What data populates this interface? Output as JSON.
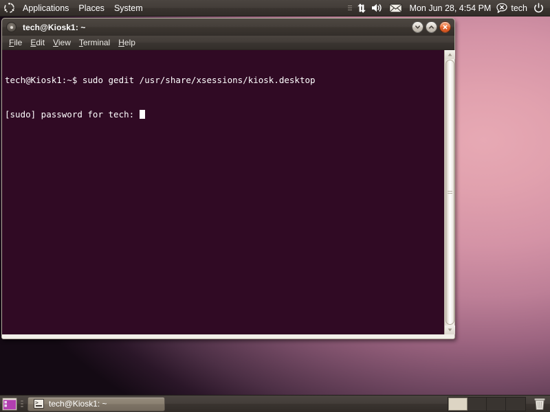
{
  "desktop": {
    "wallpaper_colors": [
      "#e7a9b4",
      "#bd7f97",
      "#4c2f45",
      "#140a14"
    ]
  },
  "top_panel": {
    "logo_icon": "ubuntu-logo-icon",
    "menus": [
      {
        "label": "Applications",
        "name": "menu-applications"
      },
      {
        "label": "Places",
        "name": "menu-places"
      },
      {
        "label": "System",
        "name": "menu-system"
      }
    ],
    "tray": {
      "indicator_applet_icon": "indicator-handle-icon",
      "network_icon": "network-up-down-icon",
      "volume_icon": "volume-speaker-icon",
      "messaging_icon": "envelope-icon",
      "clock": "Mon Jun 28,  4:54 PM",
      "user_status_icon": "user-status-offline-icon",
      "user_name": "tech",
      "power_icon": "power-button-icon"
    }
  },
  "terminal_window": {
    "title": "tech@Kiosk1: ~",
    "window_menu_icon": "window-menu-icon",
    "controls": {
      "minimize_icon": "minimize-icon",
      "maximize_icon": "maximize-icon",
      "close_icon": "close-icon"
    },
    "menubar": [
      {
        "name": "menu-file",
        "mnemonic": "F",
        "rest": "ile"
      },
      {
        "name": "menu-edit",
        "mnemonic": "E",
        "rest": "dit"
      },
      {
        "name": "menu-view",
        "mnemonic": "V",
        "rest": "iew"
      },
      {
        "name": "menu-terminal",
        "mnemonic": "T",
        "rest": "erminal"
      },
      {
        "name": "menu-help",
        "mnemonic": "H",
        "rest": "elp"
      }
    ],
    "screen": {
      "background_color": "#300a24",
      "foreground_color": "#ffffff",
      "lines": [
        "tech@Kiosk1:~$ sudo gedit /usr/share/xsessions/kiosk.desktop",
        "[sudo] password for tech: "
      ],
      "prompt_line": "tech@Kiosk1:~$ sudo gedit /usr/share/xsessions/kiosk.desktop",
      "password_prompt": "[sudo] password for tech: ",
      "cursor": "block-cursor"
    },
    "scrollbar": {
      "up_arrow_icon": "scroll-up-arrow-icon",
      "down_arrow_icon": "scroll-down-arrow-icon",
      "thumb": "scrollbar-thumb"
    }
  },
  "bottom_panel": {
    "show_desktop_icon": "show-desktop-icon",
    "task_button": {
      "label": "tech@Kiosk1: ~",
      "icon": "terminal-icon"
    },
    "workspaces": [
      {
        "name": "workspace-1",
        "active": true
      },
      {
        "name": "workspace-2",
        "active": false
      },
      {
        "name": "workspace-3",
        "active": false
      },
      {
        "name": "workspace-4",
        "active": false
      }
    ],
    "trash_icon": "trash-can-icon"
  }
}
